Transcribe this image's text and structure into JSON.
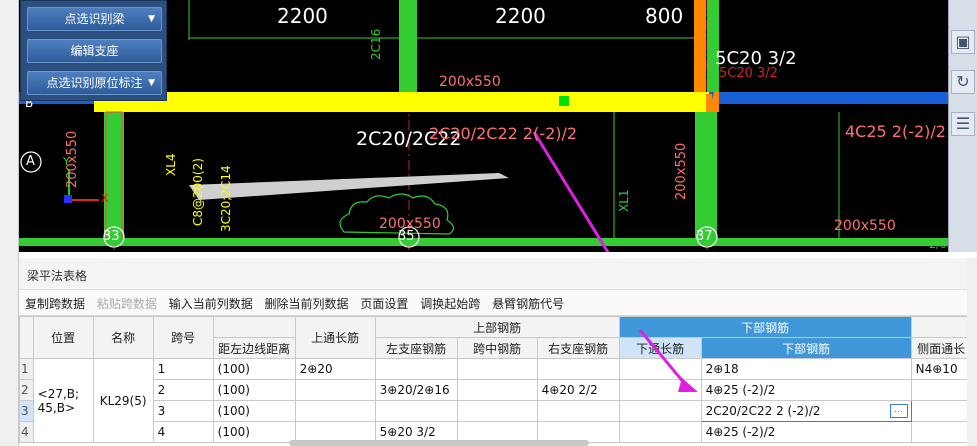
{
  "menu": {
    "btn1": "点选识别梁",
    "btn2": "编辑支座",
    "btn3": "点选识别原位标注",
    "arrow": "▼"
  },
  "cad": {
    "dim1": "2200",
    "dim2": "2200",
    "dim3": "800",
    "beam_label_right": "5C20 3/2",
    "beam_label_right_ghost": "5C20 3/2",
    "beam_label_main": "2C20/2C22",
    "beam_label_red1": "2C20/2C22 2(-2)/2",
    "beam_label_red2": "4C25 2(-2)/2",
    "size1": "200x550",
    "size2": "200x550",
    "size3": "200x550",
    "size4": "200x550",
    "size5": "200x550",
    "vlabel1": "2C16",
    "vlabel2": "XL4",
    "vlabel3": "C8@200(2)",
    "vlabel4": "3C20;2C14",
    "vlabel5": "XL1",
    "axis_a": "A",
    "axis_a2": "A",
    "axis_b": "B",
    "axis_33": "33",
    "axis_35": "35",
    "axis_37": "37",
    "axis_y": "Y",
    "axis_x": "X",
    "tail": "2/0"
  },
  "panel": {
    "title": "梁平法表格",
    "toolbar": [
      "复制跨数据",
      "粘贴跨数据",
      "输入当前列数据",
      "删除当前列数据",
      "页面设置",
      "调换起始跨",
      "悬臂钢筋代号"
    ],
    "headers": {
      "pos": "位置",
      "name": "名称",
      "span": "跨号",
      "dist": "距左边线距离",
      "top_through": "上通长筋",
      "upper": "上部钢筋",
      "left_seat": "左支座钢筋",
      "mid": "跨中钢筋",
      "right_seat": "右支座钢筋",
      "lower": "下部钢筋",
      "lower_through": "下通长筋",
      "lower_bar": "下部钢筋",
      "side": "侧面通长"
    },
    "pos_value": "<27,B;\n45,B>",
    "name_value": "KL29(5)",
    "row_nums": [
      "1",
      "2",
      "3",
      "4"
    ],
    "rows": [
      {
        "span": "1",
        "dist": "(100)",
        "top": "2⊕20",
        "left": "",
        "mid": "",
        "right": "",
        "lt": "",
        "lower": "2⊕18",
        "side": "N4⊕10"
      },
      {
        "span": "2",
        "dist": "(100)",
        "top": "",
        "left": "3⊕20/2⊕16",
        "mid": "",
        "right": "4⊕20 2/2",
        "lt": "",
        "lower": "4⊕25 (-2)/2",
        "side": ""
      },
      {
        "span": "3",
        "dist": "(100)",
        "top": "",
        "left": "",
        "mid": "",
        "right": "",
        "lt": "",
        "lower": "2C20/2C22 2 (-2)/2",
        "side": ""
      },
      {
        "span": "4",
        "dist": "(100)",
        "top": "",
        "left": "5⊕20 3/2",
        "mid": "",
        "right": "",
        "lt": "",
        "lower": "4⊕25 (-2)/2",
        "side": ""
      }
    ],
    "ellipsis": "…"
  },
  "colors": {
    "beam": "#ffff00",
    "column": "#33dd33",
    "arrow": "#e020e0",
    "header_blue": "#3f96d8"
  }
}
